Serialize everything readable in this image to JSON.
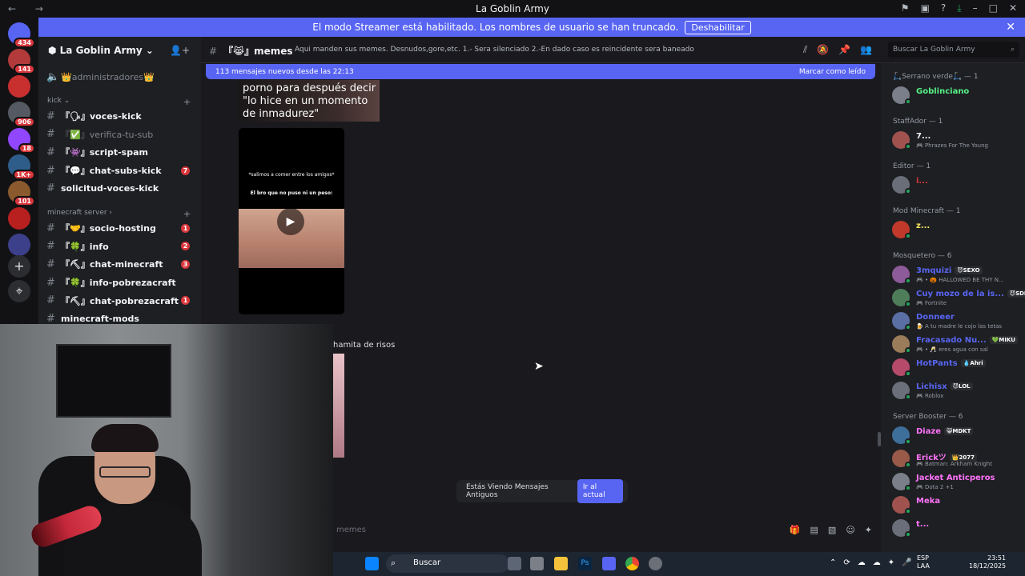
{
  "window": {
    "title": "La Goblin Army",
    "nav": "← →"
  },
  "banner": {
    "text": "El modo Streamer está habilitado. Los nombres de usuario se han truncado.",
    "button": "Deshabilitar",
    "close": "✕"
  },
  "guilds": [
    {
      "badge": "434",
      "color": "#5865f2"
    },
    {
      "badge": "141",
      "color": "#b33a3a"
    },
    {
      "badge": "",
      "color": "#c83030"
    },
    {
      "badge": "906",
      "color": "#555a62"
    },
    {
      "badge": "18",
      "color": "#9146ff"
    },
    {
      "badge": "1K+",
      "color": "#2e5d8a"
    },
    {
      "badge": "101",
      "color": "#8a5a2e"
    },
    {
      "badge": "",
      "color": "#b82020"
    },
    {
      "badge": "",
      "color": "#3c3f8a"
    }
  ],
  "sidebar": {
    "server": "La Goblin Army",
    "adminRow": "👑administradores👑",
    "kickCategory": "kick",
    "kickChannels": [
      {
        "name": "『🗣』voces-kick",
        "badge": "",
        "dim": false
      },
      {
        "name": "『✅』verifica-tu-sub",
        "badge": "",
        "dim": true
      },
      {
        "name": "『👾』script-spam",
        "badge": "",
        "dim": false
      },
      {
        "name": "『💬』chat-subs-kick",
        "badge": "7",
        "dim": false
      },
      {
        "name": "solicitud-voces-kick",
        "badge": "",
        "dim": false
      }
    ],
    "mcCategory": "minecraft server",
    "mcChannels": [
      {
        "name": "『🤝』socio-hosting",
        "badge": "1"
      },
      {
        "name": "『🍀』info",
        "badge": "2"
      },
      {
        "name": "『⛏』chat-minecraft",
        "badge": "3"
      },
      {
        "name": "『🍀』info-pobrezacraft",
        "badge": ""
      },
      {
        "name": "『⛏』chat-pobrezacraft",
        "badge": "1"
      },
      {
        "name": "minecraft-mods",
        "badge": ""
      }
    ]
  },
  "channel": {
    "name": "『😹』memes",
    "topic": "Aqui manden sus memes. Desnudos,gore,etc. 1.- Sera silenciado 2.-En dado caso es reincidente sera baneado",
    "search": "Buscar La Goblin Army"
  },
  "newMessages": {
    "text": "113 mensajes nuevos desde las 22:13",
    "mark": "Marcar como leído"
  },
  "messages": {
    "media1": "porno para después decir \"lo hice en un momento de inmadurez\"",
    "videoTop": "*salimos a comer entre los amigos*",
    "videoSub": "El bro que no puso ni un peso:",
    "line": "hamita de risos"
  },
  "oldMessages": {
    "text": "Estás Viendo Mensajes Antiguos",
    "button": "Ir al actual"
  },
  "composer": {
    "placeholder": "memes"
  },
  "members": {
    "groups": [
      {
        "title": "🛴Serrano verde🛴 — 1",
        "items": [
          {
            "name": "Goblinciano",
            "tag": "",
            "activity": "",
            "color": "#57f287"
          }
        ]
      },
      {
        "title": "StaffAdor — 1",
        "items": [
          {
            "name": "7...",
            "tag": "",
            "activity": "🎮 Phrazes For The Young",
            "color": "#f2f3f5"
          }
        ]
      },
      {
        "title": "Editor — 1",
        "items": [
          {
            "name": "i...",
            "tag": "",
            "activity": "",
            "color": "#da373c"
          }
        ]
      },
      {
        "title": "Mod Minecraft — 1",
        "items": [
          {
            "name": "z...",
            "tag": "",
            "activity": "",
            "color": "#fee75c"
          }
        ]
      },
      {
        "title": "Mosquetero — 6",
        "items": [
          {
            "name": "3mquizi",
            "tag": "😈SEXO",
            "activity": "🎮 • 🎃 HALLOWED BE THY N...",
            "color": "#5865f2"
          },
          {
            "name": "Cuy mozo de la is...",
            "tag": "😈SDLG",
            "activity": "🎮 Fortnite",
            "color": "#5865f2"
          },
          {
            "name": "Donneer",
            "tag": "",
            "activity": "🍺 A tu madre le cojo las tetas",
            "color": "#5865f2"
          },
          {
            "name": "Fracasado Nu...",
            "tag": "💚MIKU",
            "activity": "🎮 • 🥂 eres agua con sal",
            "color": "#5865f2"
          },
          {
            "name": "HotPants",
            "tag": "💧Ahri",
            "activity": "",
            "color": "#5865f2"
          },
          {
            "name": "Lichisx",
            "tag": "😈LOL",
            "activity": "🎮 Roblox",
            "color": "#5865f2"
          }
        ]
      },
      {
        "title": "Server Booster — 6",
        "items": [
          {
            "name": "Diaze",
            "tag": "😸MDKT",
            "activity": "",
            "color": "#ff73fa"
          },
          {
            "name": "Erickツ",
            "tag": "👑2077",
            "activity": "🎮 Batman: Arkham Knight",
            "color": "#ff73fa"
          },
          {
            "name": "Jacket Anticperos",
            "tag": "",
            "activity": "🎮 Dota 2 +1",
            "color": "#ff73fa"
          },
          {
            "name": "Meka",
            "tag": "",
            "activity": "",
            "color": "#ff73fa"
          },
          {
            "name": "t...",
            "tag": "",
            "activity": "",
            "color": "#ff73fa"
          }
        ]
      }
    ]
  },
  "taskbar": {
    "search": "Buscar",
    "lang1": "ESP",
    "lang2": "LAA",
    "time": "23:51",
    "date": "18/12/2025"
  }
}
